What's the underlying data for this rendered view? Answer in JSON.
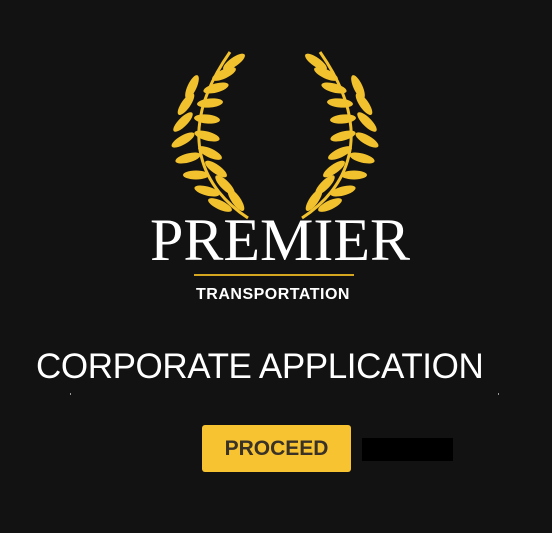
{
  "logo": {
    "brand_name": "PREMIER",
    "brand_subtitle": "TRANSPORTATION",
    "laurel_color": "#f2c12e",
    "rule_color": "#d4a61f",
    "icon": "laurel-wreath-icon"
  },
  "main": {
    "headline": "CORPORATE APPLICATION",
    "proceed_label": "PROCEED"
  },
  "colors": {
    "background": "#121212",
    "button": "#f7c331",
    "button_text": "#3a3226",
    "text": "#ffffff"
  }
}
